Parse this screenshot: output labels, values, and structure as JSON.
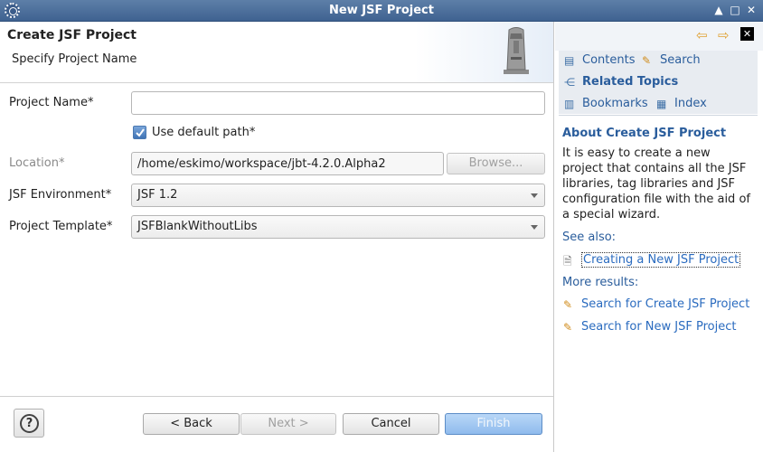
{
  "window": {
    "title": "New JSF Project"
  },
  "wizard": {
    "title": "Create JSF Project",
    "description": "Specify Project Name",
    "fields": {
      "project_name": {
        "label": "Project Name*",
        "value": ""
      },
      "use_default_path": {
        "label": "Use default path*",
        "checked": true
      },
      "location": {
        "label": "Location*",
        "value": "/home/eskimo/workspace/jbt-4.2.0.Alpha2",
        "browse": "Browse..."
      },
      "jsf_environment": {
        "label": "JSF Environment*",
        "value": "JSF 1.2"
      },
      "project_template": {
        "label": "Project Template*",
        "value": "JSFBlankWithoutLibs"
      }
    },
    "buttons": {
      "back": "< Back",
      "next": "Next >",
      "cancel": "Cancel",
      "finish": "Finish"
    }
  },
  "help": {
    "tabs": {
      "contents": "Contents",
      "search": "Search",
      "related": "Related Topics",
      "bookmarks": "Bookmarks",
      "index": "Index"
    },
    "about_title": "About Create JSF Project",
    "about_text": "It is easy to create a new project that contains all the JSF libraries, tag libraries and JSF configuration file with the aid of a special wizard.",
    "see_also_label": "See also:",
    "see_also_link": "Creating a New JSF Project",
    "more_results_label": "More results:",
    "search_links": [
      "Search for Create JSF Project",
      "Search for New JSF Project"
    ]
  }
}
